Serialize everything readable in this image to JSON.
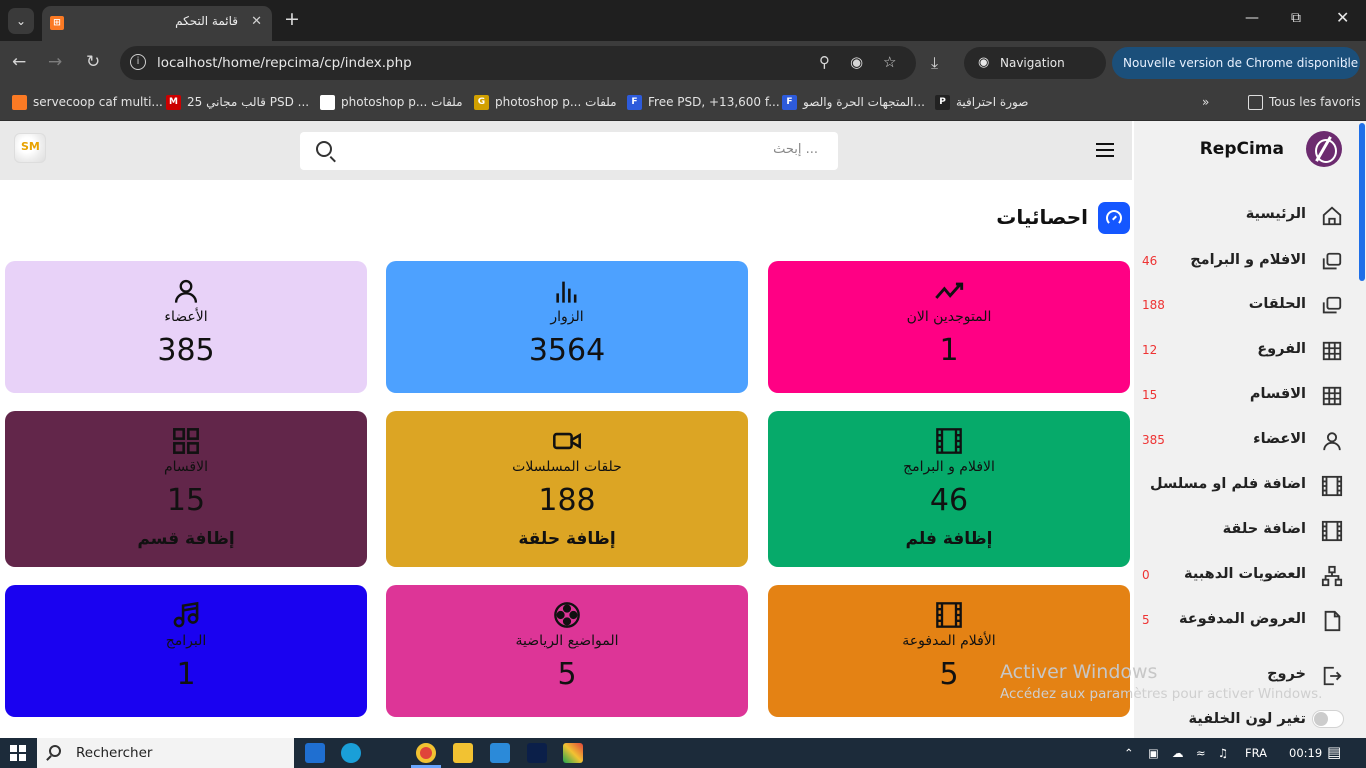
{
  "browser": {
    "tab_title": "قائمة التحكم",
    "url": "localhost/home/repcima/cp/index.php",
    "private_label": "Navigation privée",
    "update_label": "Nouvelle version de Chrome disponible",
    "bookmarks": [
      "servecoop caf multi...",
      "25 قالب مجاني PSD ...",
      "photoshop p... ملفات",
      "photoshop p... ملفات",
      "Free PSD, +13,600 f...",
      "المتجهات الحرة والصو...",
      "صورة احترافية"
    ],
    "all_favorites": "Tous les favoris"
  },
  "header": {
    "search_placeholder": "إبحث ..."
  },
  "section_title": "احصائيات",
  "cards": [
    {
      "label": "الأعضاء",
      "value": "385",
      "action": "",
      "color": "#e8d2f8",
      "icon": "user-icon"
    },
    {
      "label": "الزوار",
      "value": "3564",
      "action": "",
      "color": "#4da1ff",
      "icon": "bars-icon"
    },
    {
      "label": "المتوجدين الان",
      "value": "1",
      "action": "",
      "color": "#ff0084",
      "icon": "trend-icon"
    },
    {
      "label": "الاقسام",
      "value": "15",
      "action": "إظافة قسم",
      "color": "#62264a",
      "icon": "grid-icon"
    },
    {
      "label": "حلقات المسلسلات",
      "value": "188",
      "action": "إظافة حلقة",
      "color": "#dca524",
      "icon": "video-icon"
    },
    {
      "label": "الافلام و البرامج",
      "value": "46",
      "action": "إظافة فلم",
      "color": "#06aa6a",
      "icon": "film-icon"
    },
    {
      "label": "البرامج",
      "value": "1",
      "action": "",
      "color": "#1a02f0",
      "icon": "music-icon"
    },
    {
      "label": "المواضيع الرياضية",
      "value": "5",
      "action": "",
      "color": "#dd3597",
      "icon": "ball-icon"
    },
    {
      "label": "الأفلام المدفوعة",
      "value": "5",
      "action": "",
      "color": "#e48214",
      "icon": "film-icon"
    }
  ],
  "sidebar": {
    "brand": "RepCima",
    "items": [
      {
        "label": "الرئيسية",
        "count": "",
        "icon": "home-icon"
      },
      {
        "label": "الافلام و البرامج",
        "count": "46",
        "icon": "copy-icon"
      },
      {
        "label": "الحلقات",
        "count": "188",
        "icon": "copy-icon"
      },
      {
        "label": "الفروع",
        "count": "12",
        "icon": "table-icon"
      },
      {
        "label": "الاقسام",
        "count": "15",
        "icon": "table-icon"
      },
      {
        "label": "الاعضاء",
        "count": "385",
        "icon": "user-icon"
      },
      {
        "label": "اضافة فلم او مسلسل",
        "count": "",
        "icon": "film-icon"
      },
      {
        "label": "اضافة حلقة",
        "count": "",
        "icon": "film-icon"
      },
      {
        "label": "العضويات الدهبية",
        "count": "0",
        "icon": "network-icon"
      },
      {
        "label": "العروض المدفوعة",
        "count": "5",
        "icon": "file-icon"
      },
      {
        "label": "خروج",
        "count": "",
        "icon": "logout-icon"
      }
    ],
    "theme_toggle_label": "تغير لون الخلفية"
  },
  "watermark": {
    "line1": "Activer Windows",
    "line2": "Accédez aux paramètres pour activer Windows."
  },
  "taskbar": {
    "search_label": "Rechercher",
    "lang": "FRA",
    "time": "00:19"
  }
}
